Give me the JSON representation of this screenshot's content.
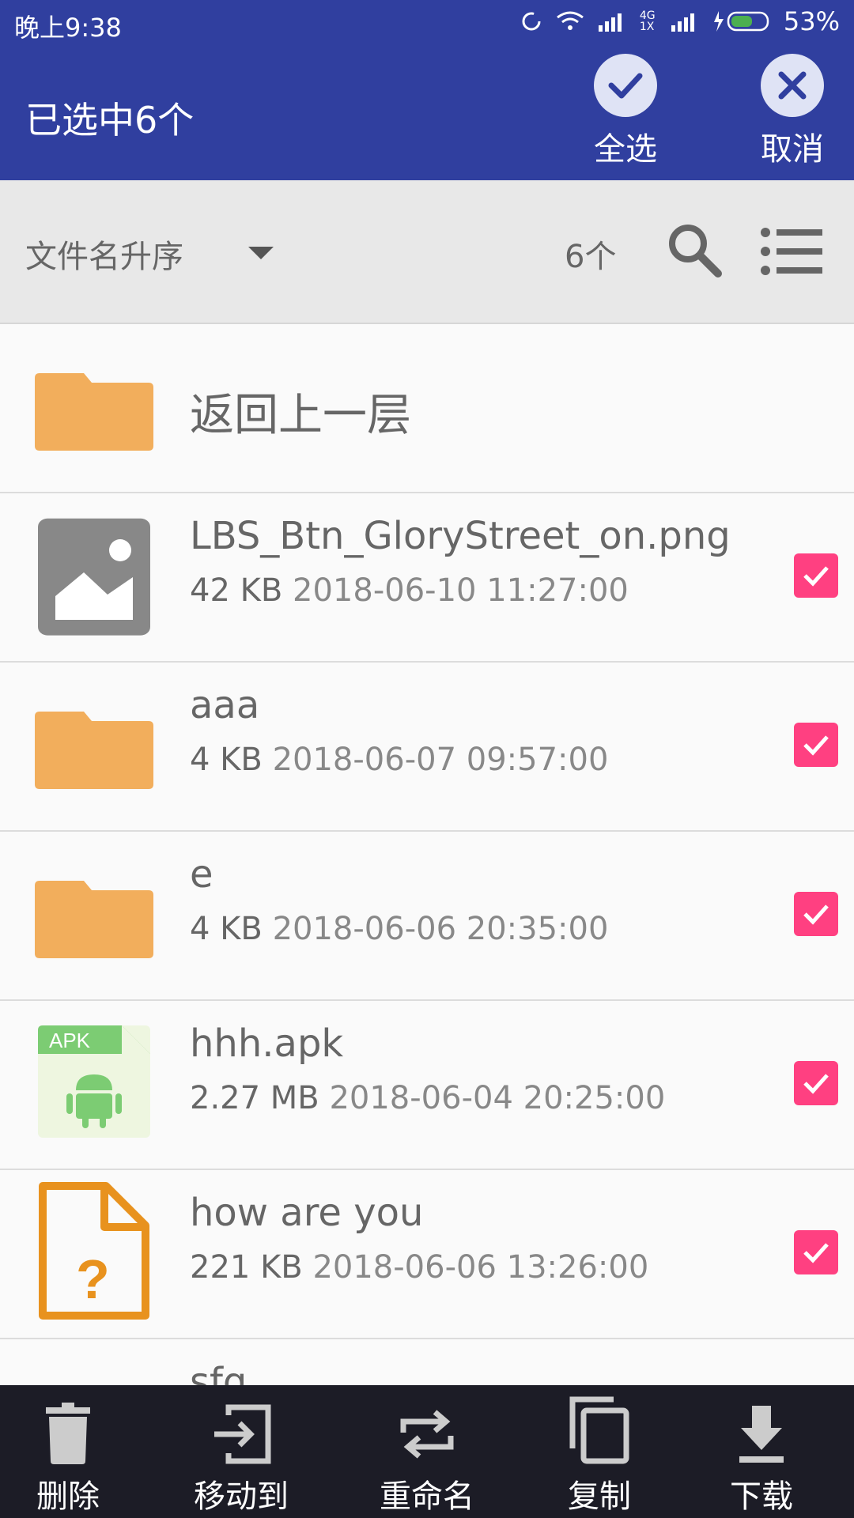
{
  "status_bar": {
    "time": "晚上9:38",
    "network": "4G 1X",
    "battery": "53%"
  },
  "app_bar": {
    "title": "已选中6个",
    "select_all_label": "全选",
    "cancel_label": "取消"
  },
  "sort_bar": {
    "sort_label": "文件名升序",
    "count_label": "6个"
  },
  "files": [
    {
      "name": "返回上一层",
      "type": "folder-up"
    },
    {
      "name": "LBS_Btn_GloryStreet_on.png",
      "size": "42 KB",
      "date": "2018-06-10 11:27:00",
      "type": "image",
      "checked": true
    },
    {
      "name": "aaa",
      "size": "4 KB",
      "date": "2018-06-07 09:57:00",
      "type": "folder",
      "checked": true
    },
    {
      "name": "e",
      "size": "4 KB",
      "date": "2018-06-06 20:35:00",
      "type": "folder",
      "checked": true
    },
    {
      "name": "hhh.apk",
      "size": "2.27 MB",
      "date": "2018-06-04 20:25:00",
      "type": "apk",
      "checked": true,
      "badge": "APK"
    },
    {
      "name": "how are you",
      "size": "221 KB",
      "date": "2018-06-06 13:26:00",
      "type": "unknown",
      "checked": true
    },
    {
      "name": "sfg",
      "type": "folder"
    }
  ],
  "bottom_bar": {
    "delete": "删除",
    "move_to": "移动到",
    "rename": "重命名",
    "copy": "复制",
    "download": "下载"
  },
  "colors": {
    "primary": "#303f9f",
    "accent": "#ff4081",
    "folder": "#f2ae5c",
    "bottom": "#1c1c26"
  }
}
